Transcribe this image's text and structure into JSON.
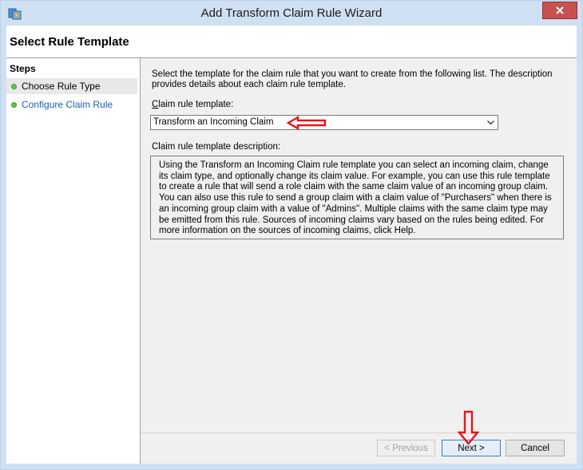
{
  "window": {
    "title": "Add Transform Claim Rule Wizard",
    "icon": "wizard-app-icon",
    "close_icon": "close-icon"
  },
  "header": {
    "page_title": "Select Rule Template"
  },
  "steps": {
    "title": "Steps",
    "items": [
      {
        "label": "Choose Rule Type",
        "state": "current"
      },
      {
        "label": "Configure Claim Rule",
        "state": "link"
      }
    ],
    "dot_color": "#5ec94a"
  },
  "main": {
    "intro": "Select the template for the claim rule that you want to create from the following list. The description provides details about each claim rule template.",
    "template_label_prefix": "C",
    "template_label_rest": "laim rule template:",
    "template_value": "Transform an Incoming Claim",
    "description_label": "Claim rule template description:",
    "description": "Using the Transform an Incoming Claim rule template you can select an incoming claim, change its claim type, and optionally change its claim value.  For example, you can use this rule template to create a rule that will send a role claim with the same claim value of an incoming group claim.  You can also use this rule to send a group claim with a claim value of \"Purchasers\" when there is an incoming group claim with a value of \"Admins\".  Multiple claims with the same claim type may be emitted from this rule.  Sources of incoming claims vary based on the rules being edited.  For more information on the sources of incoming claims, click Help."
  },
  "buttons": {
    "previous": "< Previous",
    "next": "Next >",
    "cancel": "Cancel"
  },
  "annotations": {
    "arrow_color": "#e8141b"
  }
}
